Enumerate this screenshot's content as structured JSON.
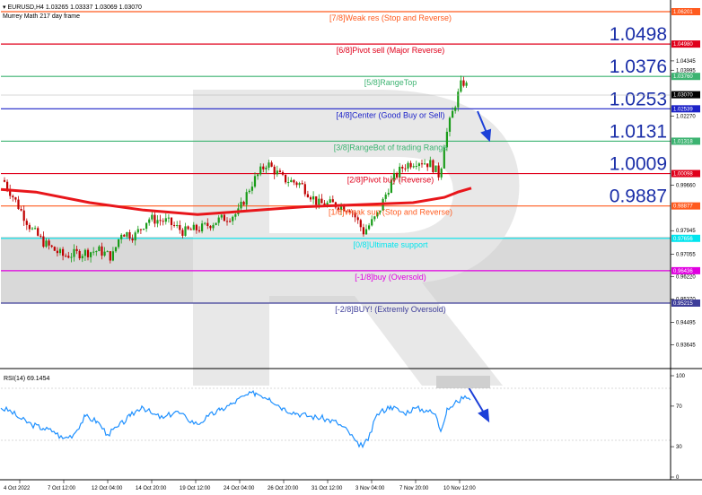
{
  "header": {
    "symbol_line": "EURUSD,H4  1.03265 1.03337 1.03069 1.03070",
    "indicator_name": "Murrey Math 217 day frame"
  },
  "rsi": {
    "label": "RSI(14) 69.1454",
    "ticks": [
      "100",
      "70",
      "30",
      "0"
    ]
  },
  "price_axis": {
    "ticks": [
      "1.04345",
      "1.03995",
      "1.02270",
      "0.99660",
      "0.97945",
      "0.97055",
      "0.96220",
      "0.95370",
      "0.94495",
      "0.93645"
    ],
    "current_price": "1.03070",
    "current_price_color": "#000000"
  },
  "levels": [
    {
      "id": "7-8",
      "label": "[7/8]Weak res (Stop and Reverse)",
      "value": "1.06201",
      "color": "#ff5b1f"
    },
    {
      "id": "6-8",
      "label": "[6/8]Pivot sell (Major Reverse)",
      "value": "1.04980",
      "color": "#e0001b",
      "big": "1.0498"
    },
    {
      "id": "5-8",
      "label": "[5/8]RangeTop",
      "value": "1.03760",
      "color": "#3cb371",
      "big": "1.0376"
    },
    {
      "id": "4-8",
      "label": "[4/8]Center (Good Buy or Sell)",
      "value": "1.02539",
      "color": "#1c22c8",
      "big": "1.0253"
    },
    {
      "id": "3-8",
      "label": "[3/8]RangeBot of trading Range",
      "value": "1.01318",
      "color": "#3cb371",
      "big": "1.0131"
    },
    {
      "id": "2-8",
      "label": "[2/8]Pivot buy (Reverse)",
      "value": "1.00098",
      "color": "#e0001b",
      "big": "1.0009"
    },
    {
      "id": "1-8",
      "label": "[1/8]Weak sup (Stop and Reverse)",
      "value": "0.98877",
      "color": "#ff5b1f",
      "big": "0.9887"
    },
    {
      "id": "0-8",
      "label": "[0/8]Ultimate support",
      "value": "0.97656",
      "color": "#00e5ee"
    },
    {
      "id": "-1-8",
      "label": "[-1/8]buy (Oversold)",
      "value": "0.96436",
      "color": "#e000e0"
    },
    {
      "id": "-2-8",
      "label": "[-2/8]BUY! (Extremly Oversold)",
      "value": "0.95215",
      "color": "#3d3d99"
    }
  ],
  "time_axis": {
    "labels": [
      "4 Oct 2022",
      "7 Oct 12:00",
      "12 Oct 04:00",
      "14 Oct 20:00",
      "19 Oct 12:00",
      "24 Oct 04:00",
      "26 Oct 20:00",
      "31 Oct 12:00",
      "3 Nov 04:00",
      "7 Nov 20:00",
      "10 Nov 12:00"
    ]
  },
  "colors": {
    "bull_candle": "#1a9c1a",
    "bear_candle": "#c00000",
    "moving_average": "#e8161b",
    "rsi_line": "#1e90ff",
    "forecast_arrow": "#1c3fd8",
    "watermark": "#e3e3e3"
  }
}
